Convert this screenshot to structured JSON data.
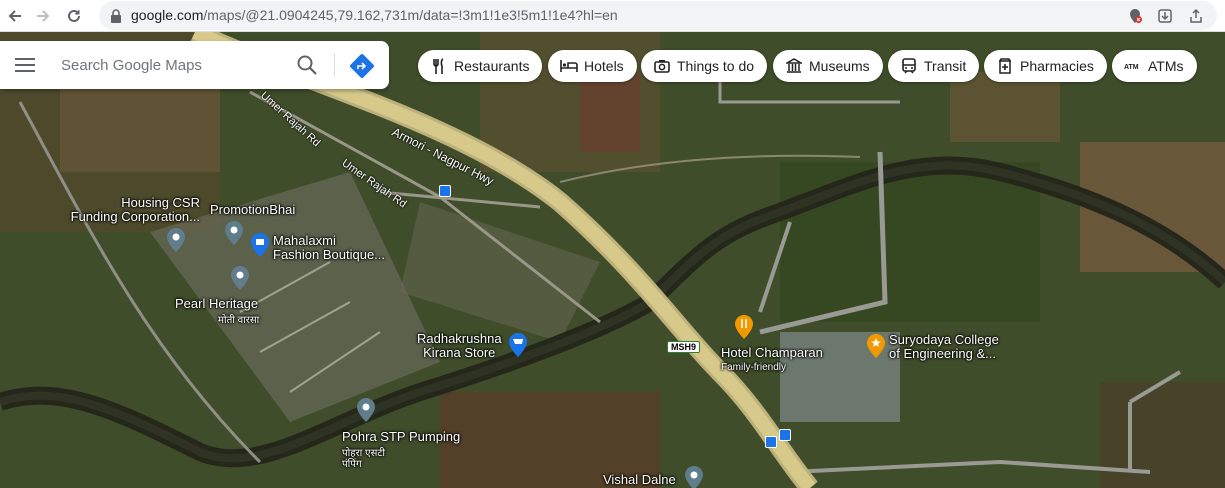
{
  "browser": {
    "url_host": "google.com",
    "url_path": "/maps/@21.0904245,79.162,731m/data=!3m1!1e3!5m1!1e4?hl=en"
  },
  "search": {
    "placeholder": "Search Google Maps"
  },
  "chips": [
    {
      "label": "Restaurants",
      "icon": "fork-knife-icon"
    },
    {
      "label": "Hotels",
      "icon": "bed-icon"
    },
    {
      "label": "Things to do",
      "icon": "camera-icon"
    },
    {
      "label": "Museums",
      "icon": "museum-icon"
    },
    {
      "label": "Transit",
      "icon": "train-icon"
    },
    {
      "label": "Pharmacies",
      "icon": "pharmacy-icon"
    },
    {
      "label": "ATMs",
      "icon": "atm-icon"
    }
  ],
  "map": {
    "type": "satellite",
    "roads": {
      "hwy": "Armori - Nagpur Hwy",
      "umer1": "Umer Rajah Rd",
      "umer2": "Umer Rajah Rd",
      "shield": "MSH9"
    },
    "places": {
      "housing": "Housing CSR\nFunding Corporation...",
      "promotion": "PromotionBhai",
      "mahalaxmi": "Mahalaxmi\nFashion Boutique...",
      "pearl": "Pearl Heritage",
      "pearl_local": "मोती वारसा",
      "radhakrushna": "Radhakrushna\nKirana Store",
      "hotel": "Hotel Champaran",
      "hotel_sub": "Family-friendly",
      "suryodaya": "Suryodaya College\nof Engineering &...",
      "pohra": "Pohra STP Pumping",
      "pohra_local": "पोहरा एसटी\nपंपिंग",
      "vishal": "Vishal Dalne"
    }
  },
  "colors": {
    "accent": "#1a73e8",
    "gray_pin": "#5f7a8a",
    "orange_pin": "#f29900",
    "road": "#d7c98a"
  }
}
